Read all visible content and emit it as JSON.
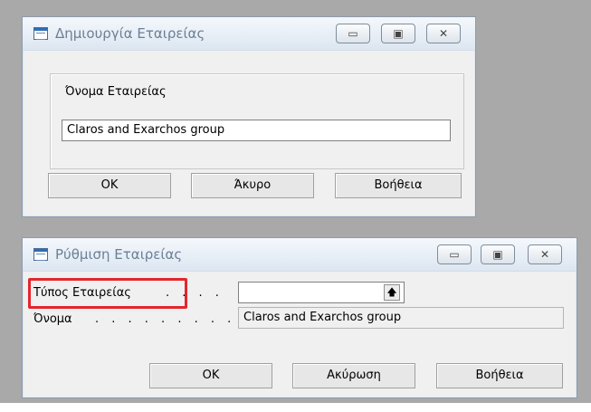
{
  "dialog1": {
    "title": "Δημιουργία Εταιρείας",
    "field_label": "Όνομα Εταιρείας",
    "field_value": "Claros and Exarchos group",
    "ok_label": "OK",
    "cancel_label": "Άκυρο",
    "help_label": "Βοήθεια"
  },
  "dialog2": {
    "title": "Ρύθμιση Εταιρείας",
    "type_label": "Τύπος Εταιρείας",
    "type_dots": ". . . .",
    "type_value": "",
    "name_label": "Όνομα",
    "name_dots": ". . . . . . . . .",
    "name_value": "Claros and Exarchos group",
    "ok_label": "OK",
    "cancel_label": "Ακύρωση",
    "help_label": "Βοήθεια"
  },
  "window_buttons": {
    "minimize": "▭",
    "maximize": "▣",
    "close": "✕"
  },
  "colors": {
    "highlight": "#e3262c",
    "title_text": "#6d7f95"
  }
}
